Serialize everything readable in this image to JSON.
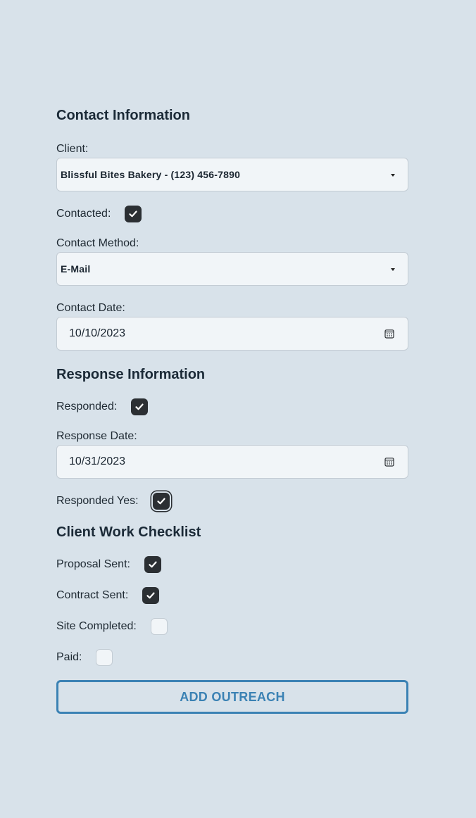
{
  "contact_section": {
    "title": "Contact Information",
    "client_label": "Client:",
    "client_value": "Blissful Bites Bakery - (123) 456-7890",
    "contacted_label": "Contacted:",
    "contacted_checked": true,
    "method_label": "Contact Method:",
    "method_value": "E-Mail",
    "date_label": "Contact Date:",
    "date_value": "10/10/2023"
  },
  "response_section": {
    "title": "Response Information",
    "responded_label": "Responded:",
    "responded_checked": true,
    "date_label": "Response Date:",
    "date_value": "10/31/2023",
    "responded_yes_label": "Responded Yes:",
    "responded_yes_checked": true
  },
  "checklist_section": {
    "title": "Client Work Checklist",
    "proposal_label": "Proposal Sent:",
    "proposal_checked": true,
    "contract_label": "Contract Sent:",
    "contract_checked": true,
    "site_label": "Site Completed:",
    "site_checked": false,
    "paid_label": "Paid:",
    "paid_checked": false
  },
  "submit_label": "ADD OUTREACH",
  "colors": {
    "background": "#d8e2ea",
    "accent": "#3b82b4",
    "checkbox_checked": "#2b2f33"
  }
}
